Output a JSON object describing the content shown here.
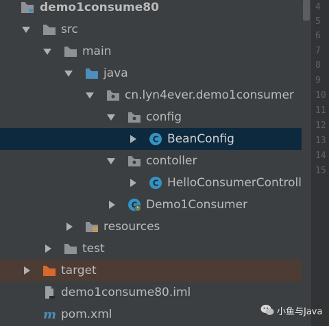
{
  "tree": {
    "project": "demo1consume80",
    "src": "src",
    "main": "main",
    "java": "java",
    "package": "cn.lyn4ever.demo1consumer",
    "config": "config",
    "bean_config": "BeanConfig",
    "contoller": "contoller",
    "hello_controller": "HelloConsumerControlle",
    "app_class": "Demo1Consumer",
    "resources": "resources",
    "test": "test",
    "target": "target",
    "iml": "demo1consume80.iml",
    "pom": "pom.xml"
  },
  "gutter": {
    "line_numbers": [
      "4",
      "5",
      "6",
      "7",
      "8",
      "9",
      "10",
      "11",
      "12",
      "13",
      "14",
      "15"
    ]
  },
  "watermark": {
    "text": "小鱼与Java"
  },
  "colors": {
    "background": "#3c3f41",
    "selected_row": "#0d293e",
    "target_row": "#4d3c33",
    "folder": "#8e9296",
    "source_folder": "#4c8fbd",
    "class_icon": "#3592c4",
    "excluded_folder": "#d46b2a"
  },
  "icons": [
    "folder-icon",
    "source-folder-icon",
    "package-icon",
    "class-icon",
    "resources-folder-icon",
    "excluded-folder-icon",
    "file-icon",
    "maven-icon",
    "spring-boot-icon"
  ]
}
